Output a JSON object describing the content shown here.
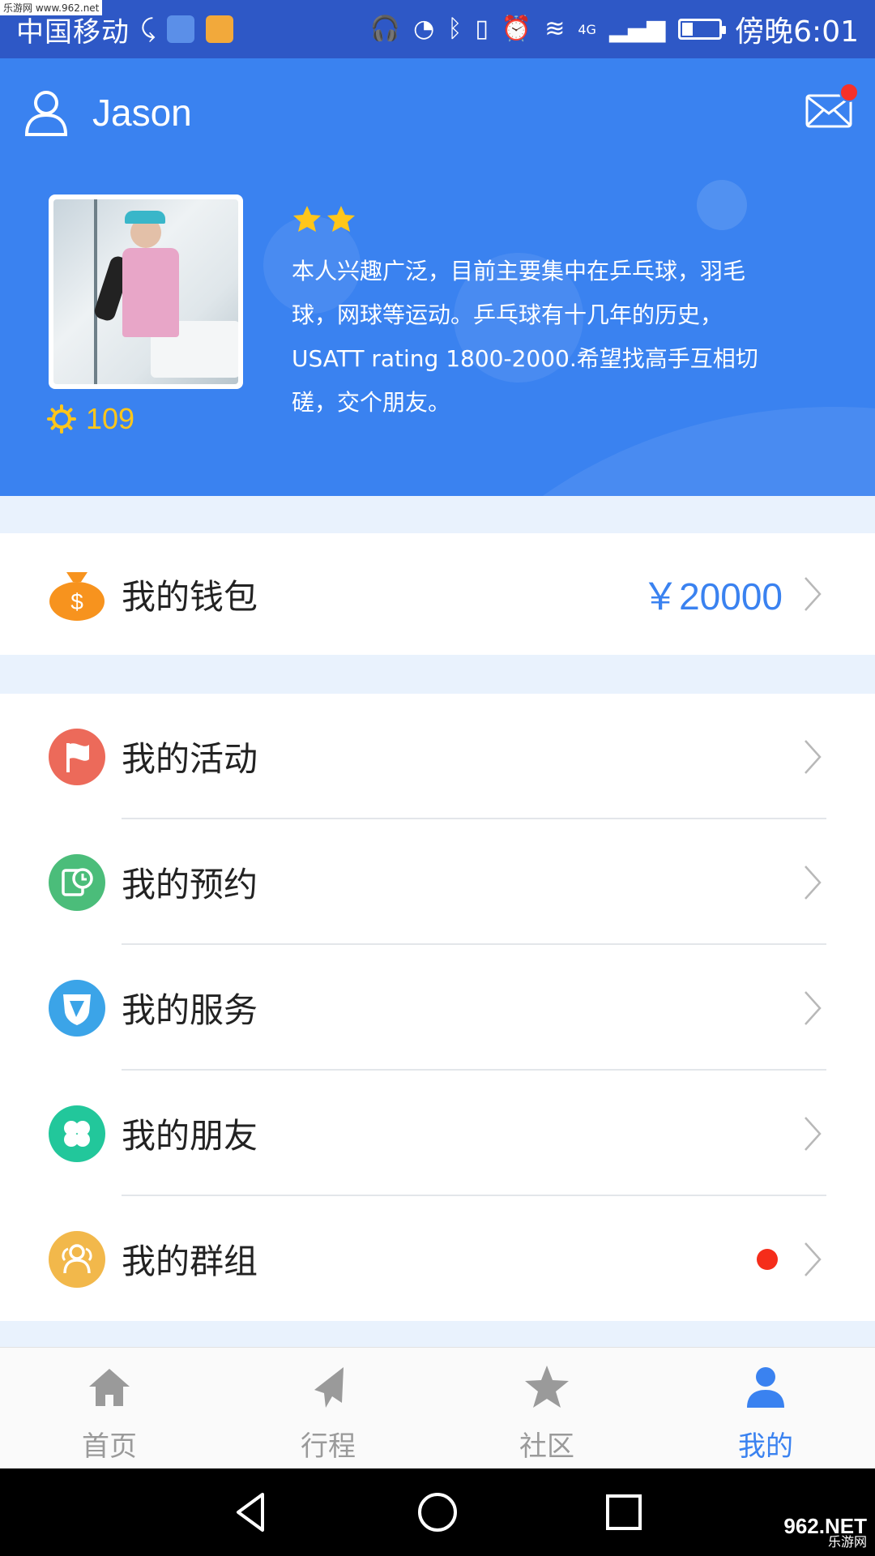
{
  "watermark": "乐游网 www.962.net",
  "status_bar": {
    "carrier": "中国移动",
    "network": "4G",
    "time": "傍晚6:01",
    "battery_level": 0.3
  },
  "profile": {
    "username": "Jason",
    "points": "109",
    "stars": 2,
    "bio": "本人兴趣广泛，目前主要集中在乒乓球，羽毛球，网球等运动。乒乓球有十几年的历史，USATT rating 1800-2000.希望找高手互相切磋，交个朋友。",
    "mail_unread": true
  },
  "wallet": {
    "label": "我的钱包",
    "amount": "￥20000"
  },
  "menu": [
    {
      "label": "我的活动",
      "icon": "flag-icon",
      "color": "#ec6a5a"
    },
    {
      "label": "我的预约",
      "icon": "clock-icon",
      "color": "#4bbd7a"
    },
    {
      "label": "我的服务",
      "icon": "shield-icon",
      "color": "#3ba4e8"
    },
    {
      "label": "我的朋友",
      "icon": "clover-icon",
      "color": "#22c79b"
    },
    {
      "label": "我的群组",
      "icon": "group-icon",
      "color": "#f2b84b",
      "badge": true
    }
  ],
  "tabs": [
    {
      "label": "首页",
      "icon": "home-icon"
    },
    {
      "label": "行程",
      "icon": "paper-plane-icon"
    },
    {
      "label": "社区",
      "icon": "star-icon"
    },
    {
      "label": "我的",
      "icon": "person-icon",
      "active": true
    }
  ],
  "footer_brand": {
    "name": "962.NET",
    "sub": "乐游网"
  },
  "colors": {
    "primary": "#3a82f0",
    "status_bar": "#2e58c6",
    "points": "#ffc61a",
    "badge": "#f52d1a"
  }
}
